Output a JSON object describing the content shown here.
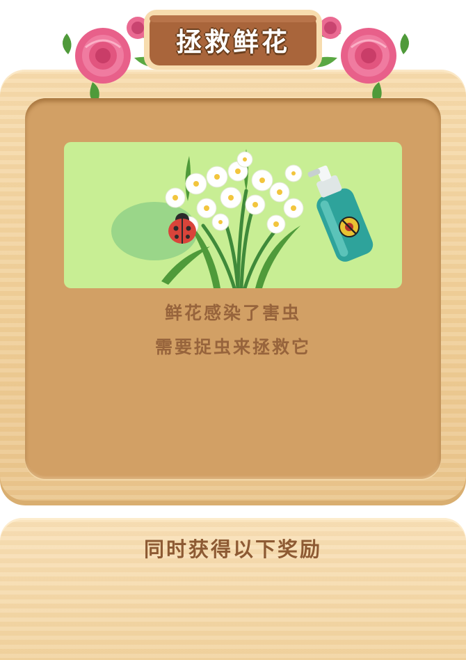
{
  "dialog": {
    "title": "拯救鲜花",
    "message_line1": "鲜花感染了害虫",
    "message_line2": "需要捉虫来拯救它"
  },
  "reward": {
    "title": "同时获得以下奖励"
  },
  "scene": {
    "icons": [
      "ladybug-icon",
      "spray-bottle-icon",
      "no-bug-icon",
      "narcissus-flowers"
    ]
  },
  "colors": {
    "board": "#f0cf98",
    "panel": "#d2a065",
    "scene_bg": "#c8ee94",
    "text": "#97643c",
    "title_plate": "#a9653b"
  }
}
